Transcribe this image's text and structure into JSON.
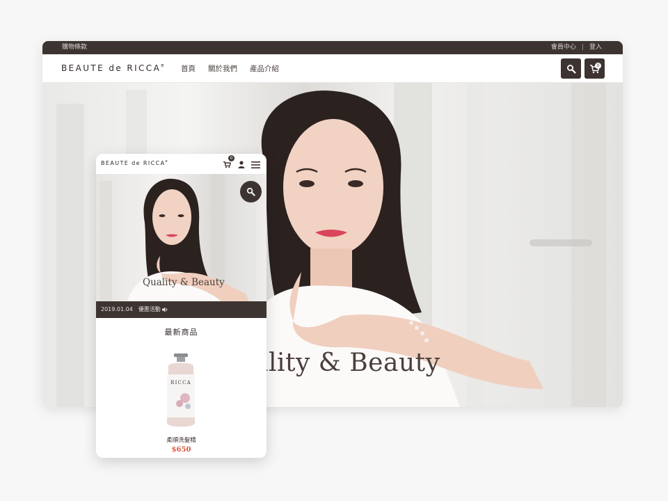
{
  "desktop": {
    "topbar": {
      "terms_link": "購物條款",
      "member_center": "會員中心",
      "separator": "|",
      "login": "登入"
    },
    "header": {
      "logo_text": "BEAUTE de RICCA",
      "logo_mark": "e",
      "nav": [
        "首頁",
        "關於我們",
        "產品介紹"
      ],
      "search_icon": "search-icon",
      "cart_icon": "cart-icon",
      "cart_count": "0"
    },
    "hero": {
      "title": "ality & Beauty"
    }
  },
  "mobile": {
    "header": {
      "logo_text": "BEAUTE de RICCA",
      "logo_mark": "e",
      "cart_count": "0",
      "icons": [
        "cart-icon",
        "user-icon",
        "menu-icon"
      ]
    },
    "hero": {
      "title": "Quality & Beauty",
      "search_icon": "search-icon"
    },
    "news": {
      "date": "2019.01.04",
      "text": "優惠活動",
      "icon": "speaker-icon"
    },
    "section_title": "最新商品",
    "product": {
      "label_brand": "RICCA",
      "name": "柔順洗髮精",
      "price": "$650"
    }
  },
  "colors": {
    "dark": "#3d3431",
    "price": "#d8563f",
    "background": "#f7f7f7"
  }
}
